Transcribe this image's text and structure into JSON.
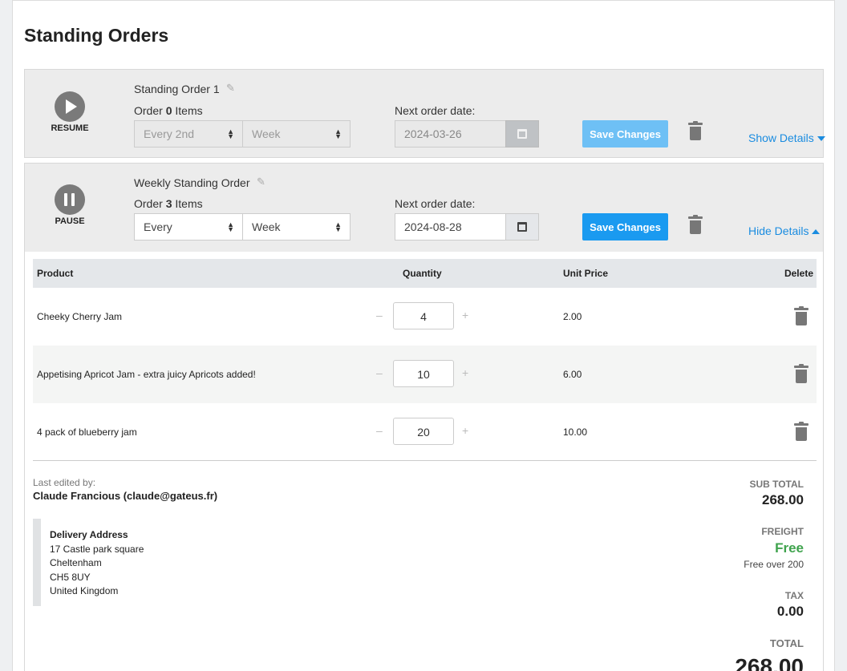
{
  "page": {
    "title": "Standing Orders"
  },
  "orders": [
    {
      "name": "Standing Order 1",
      "control_label": "RESUME",
      "items_prefix": "Order",
      "items_count": "0",
      "items_suffix": "Items",
      "frequency": "Every 2nd",
      "period": "Week",
      "next_date_label": "Next order date:",
      "next_date": "2024-03-26",
      "save_label": "Save Changes",
      "details_label": "Show Details"
    },
    {
      "name": "Weekly Standing Order",
      "control_label": "PAUSE",
      "items_prefix": "Order",
      "items_count": "3",
      "items_suffix": "Items",
      "frequency": "Every",
      "period": "Week",
      "next_date_label": "Next order date:",
      "next_date": "2024-08-28",
      "save_label": "Save Changes",
      "details_label": "Hide Details"
    }
  ],
  "table": {
    "headers": {
      "product": "Product",
      "quantity": "Quantity",
      "unit_price": "Unit Price",
      "delete": "Delete"
    },
    "rows": [
      {
        "product": "Cheeky Cherry Jam",
        "quantity": "4",
        "price": "2.00",
        "minus": "–",
        "plus": "+"
      },
      {
        "product": "Appetising Apricot Jam - extra juicy Apricots added!",
        "quantity": "10",
        "price": "6.00",
        "minus": "–",
        "plus": "+"
      },
      {
        "product": "4 pack of blueberry jam",
        "quantity": "20",
        "price": "10.00",
        "minus": "–",
        "plus": "+"
      }
    ]
  },
  "footer": {
    "last_edited_label": "Last edited by:",
    "last_edited_by": "Claude Francious (claude@gateus.fr)",
    "address": {
      "heading": "Delivery Address",
      "line1": "17 Castle park square",
      "line2": "Cheltenham",
      "line3": "CH5 8UY",
      "line4": "United Kingdom"
    },
    "totals": {
      "subtotal_label": "SUB TOTAL",
      "subtotal": "268.00",
      "freight_label": "FREIGHT",
      "freight": "Free",
      "freight_note": "Free over 200",
      "tax_label": "TAX",
      "tax": "0.00",
      "total_label": "TOTAL",
      "total": "268.00"
    }
  },
  "colors": {
    "accent": "#1a9af0",
    "link": "#1a8ce0",
    "free": "#3fa34d"
  },
  "icons": [
    "play-icon",
    "pause-icon",
    "pencil-icon",
    "calendar-icon",
    "trash-icon",
    "caret-down-icon",
    "caret-up-icon"
  ]
}
